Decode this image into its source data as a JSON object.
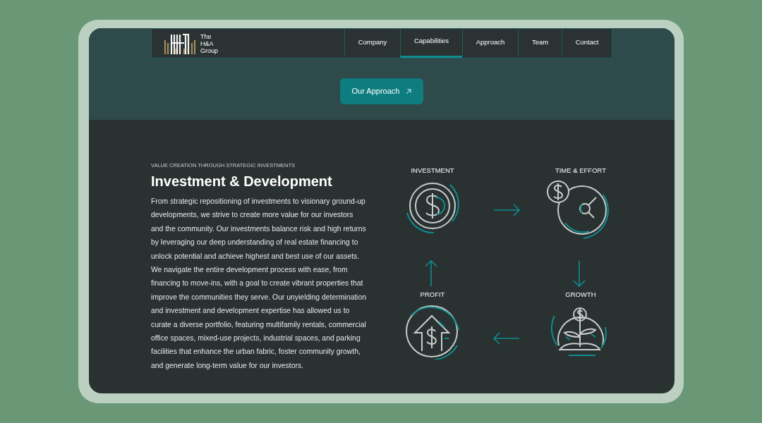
{
  "logo": {
    "lines": [
      "The",
      "H&A",
      "Group"
    ]
  },
  "nav": [
    {
      "label": "Company",
      "selected": false
    },
    {
      "label": "Capabilities",
      "selected": true
    },
    {
      "label": "Approach",
      "selected": false
    },
    {
      "label": "Team",
      "selected": false
    },
    {
      "label": "Contact",
      "selected": false
    }
  ],
  "hero_button": {
    "label": "Our Approach"
  },
  "section": {
    "eyebrow": "VALUE CREATION THROUGH STRATEGIC INVESTMENTS",
    "title": "Investment & Development",
    "body": "From strategic repositioning of investments to visionary ground-up developments, we strive to create more value for our investors and the community. Our investments balance risk and high returns by leveraging our deep understanding of real estate financing to unlock potential and achieve highest and best use of our assets. We navigate the entire development process with ease, from financing to move-ins, with a goal to create vibrant properties that improve the communities they serve. Our unyielding determination and investment and development expertise has allowed us to curate a diverse portfolio, featuring multifamily rentals, commercial office spaces, mixed-use projects, industrial spaces, and parking facilities that enhance the urban fabric, foster community growth, and generate long-term value for our investors."
  },
  "cycle": [
    {
      "label": "INVESTMENT",
      "kind": "coin"
    },
    {
      "label": "TIME & EFFORT",
      "kind": "time"
    },
    {
      "label": "PROFIT",
      "kind": "house"
    },
    {
      "label": "GROWTH",
      "kind": "plant"
    }
  ]
}
